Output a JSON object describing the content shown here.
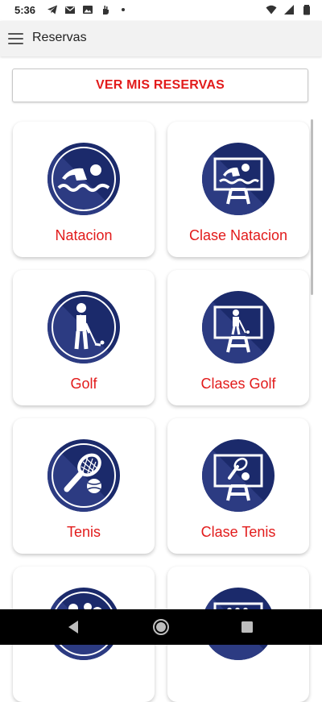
{
  "status_bar": {
    "time": "5:36",
    "left_icons": [
      "telegram-icon",
      "gmail-icon",
      "gallery-icon",
      "hand-icon",
      "dot-icon"
    ],
    "right_icons": [
      "wifi-icon",
      "signal-icon",
      "battery-icon"
    ]
  },
  "app_bar": {
    "title": "Reservas"
  },
  "primary_button": {
    "label": "VER MIS RESERVAS"
  },
  "cards": [
    {
      "label": "Natacion",
      "icon": "swimming-icon"
    },
    {
      "label": "Clase Natacion",
      "icon": "swimming-class-icon"
    },
    {
      "label": "Golf",
      "icon": "golf-icon"
    },
    {
      "label": "Clases Golf",
      "icon": "golf-class-icon"
    },
    {
      "label": "Tenis",
      "icon": "tennis-icon"
    },
    {
      "label": "Clase Tenis",
      "icon": "tennis-class-icon"
    },
    {
      "label": "",
      "icon": "group-activity-icon"
    },
    {
      "label": "",
      "icon": "class-icon"
    }
  ],
  "colors": {
    "accent": "#e21b1b",
    "icon_navy": "#1b2a6b",
    "app_bar_bg": "#f2f2f2"
  },
  "nav_bar": {
    "buttons": [
      "back-icon",
      "home-icon",
      "recents-icon"
    ]
  }
}
